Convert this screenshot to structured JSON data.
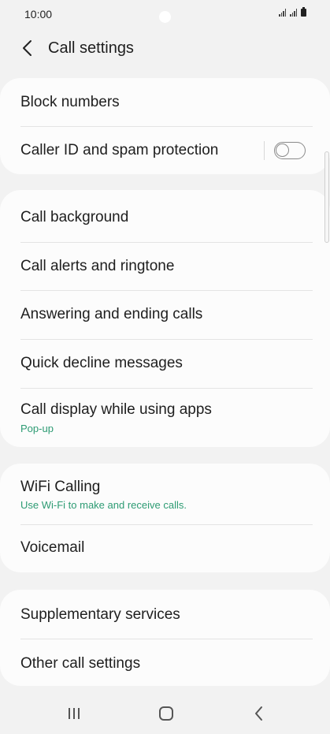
{
  "status_bar": {
    "time": "10:00",
    "icons": [
      "signal-icon",
      "signal-icon",
      "battery-icon"
    ]
  },
  "header": {
    "title": "Call settings",
    "back_icon": "back-arrow-icon"
  },
  "sections": [
    {
      "items": [
        {
          "label": "Block numbers"
        },
        {
          "label": "Caller ID and spam protection",
          "toggle": false
        }
      ]
    },
    {
      "items": [
        {
          "label": "Call background"
        },
        {
          "label": "Call alerts and ringtone"
        },
        {
          "label": "Answering and ending calls"
        },
        {
          "label": "Quick decline messages"
        },
        {
          "label": "Call display while using apps",
          "subtitle": "Pop-up"
        }
      ]
    },
    {
      "items": [
        {
          "label": "WiFi Calling",
          "subtitle": "Use Wi-Fi to make and receive calls."
        },
        {
          "label": "Voicemail"
        }
      ]
    },
    {
      "items": [
        {
          "label": "Supplementary services"
        },
        {
          "label": "Other call settings"
        }
      ]
    }
  ],
  "colors": {
    "accent_subtitle": "#2d9b73",
    "background": "#f2f2f2",
    "card": "#fcfcfc"
  },
  "nav_bar": {
    "icons": [
      "recent-apps-icon",
      "home-icon",
      "back-icon"
    ]
  }
}
